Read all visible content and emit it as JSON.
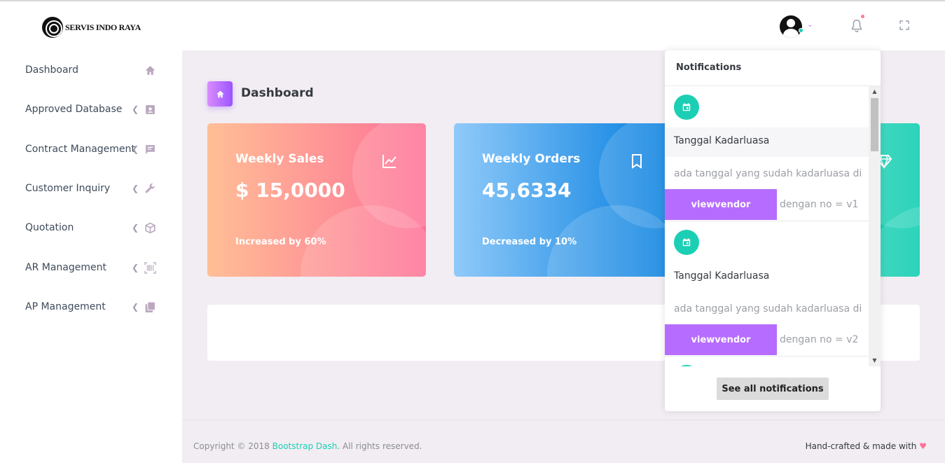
{
  "brand": {
    "name": "SERVIS INDO RAYA"
  },
  "sidebar": {
    "items": [
      {
        "label": "Dashboard",
        "icon": "home-icon",
        "has_arrow": false
      },
      {
        "label": "Approved Database",
        "icon": "contact-card-icon",
        "has_arrow": true
      },
      {
        "label": "Contract Management",
        "icon": "message-text-icon",
        "has_arrow": true
      },
      {
        "label": "Customer Inquiry",
        "icon": "wrench-icon",
        "has_arrow": true
      },
      {
        "label": "Quotation",
        "icon": "cube-icon",
        "has_arrow": true
      },
      {
        "label": "AR Management",
        "icon": "barcode-icon",
        "has_arrow": true
      },
      {
        "label": "AP Management",
        "icon": "book-icon",
        "has_arrow": true
      }
    ]
  },
  "page": {
    "title": "Dashboard"
  },
  "cards": [
    {
      "title": "Weekly Sales",
      "value": "$ 15,0000",
      "footer": "Increased by 60%",
      "icon": "chart-line-icon"
    },
    {
      "title": "Weekly Orders",
      "value": "45,6334",
      "footer": "Decreased by 10%",
      "icon": "bookmark-icon"
    },
    {
      "title": "",
      "value": "",
      "footer": "",
      "icon": "diamond-icon"
    }
  ],
  "notifications": {
    "title": "Notifications",
    "items": [
      {
        "title": "Tanggal Kadarluasa",
        "text": "ada tanggal yang sudah kadarluasa di",
        "button": "viewvendor",
        "tail": "dengan no = v1",
        "highlighted": true
      },
      {
        "title": "Tanggal Kadarluasa",
        "text": "ada tanggal yang sudah kadarluasa di",
        "button": "viewvendor",
        "tail": "dengan no = v2",
        "highlighted": false
      }
    ],
    "see_all": "See all notifications"
  },
  "footer": {
    "copyright": "Copyright © 2018 ",
    "link": "Bootstrap Dash",
    "rights": ". All rights reserved.",
    "right_text": "Hand-crafted & made with",
    "heart": "♥"
  },
  "colors": {
    "accent": "#b66dff",
    "success": "#1bcfb4",
    "danger_gradient": [
      "#ffbf96",
      "#fe7096"
    ],
    "info_gradient": [
      "#90caf9",
      "#047edf"
    ],
    "teal_gradient": [
      "#84d9d2",
      "#07cdae"
    ]
  }
}
